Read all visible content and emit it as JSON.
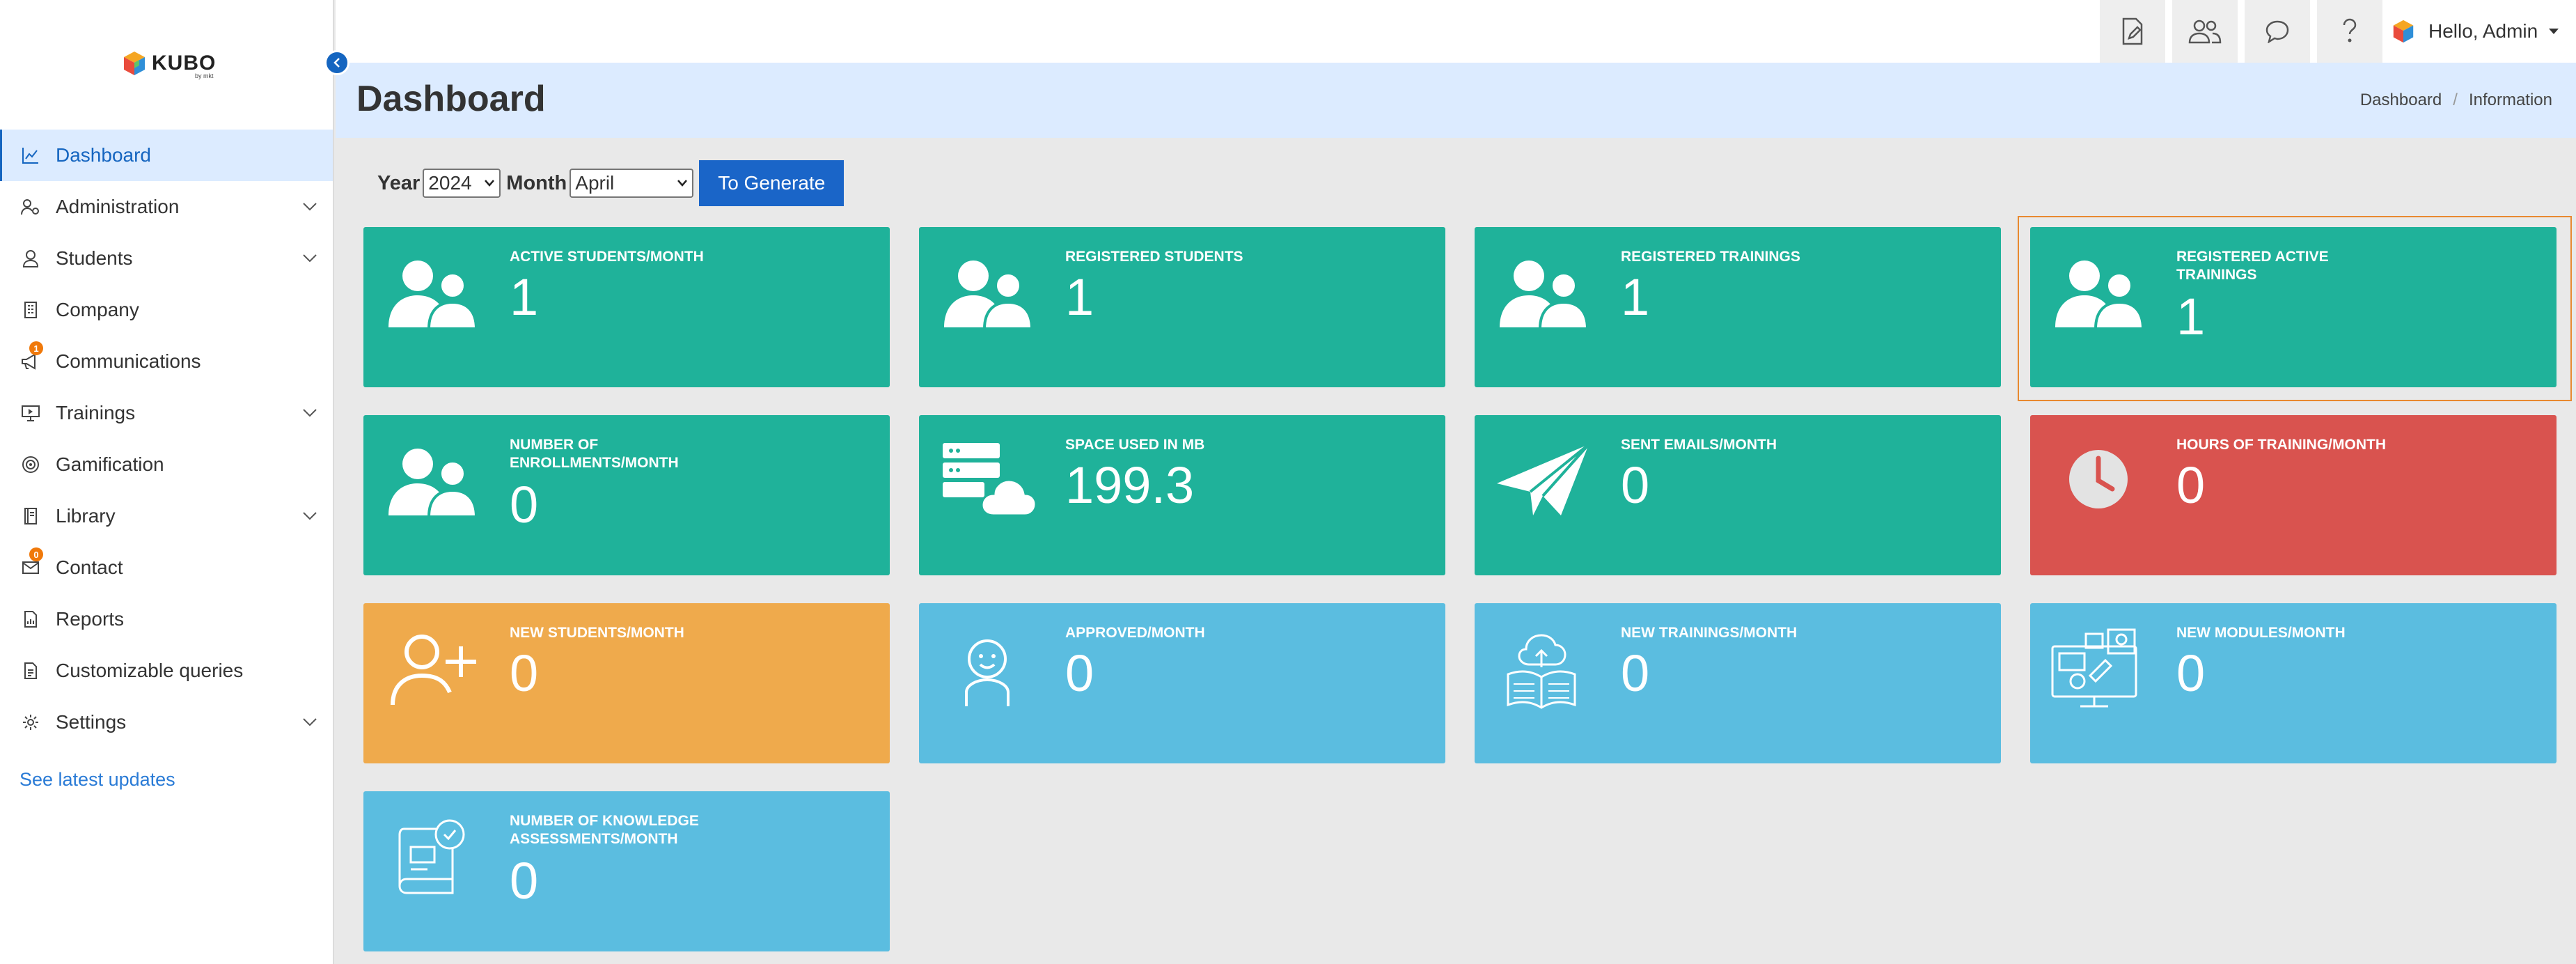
{
  "app": {
    "logo_text": "KUBO",
    "logo_sub": "by mkt"
  },
  "sidebar": {
    "items": [
      {
        "label": "Dashboard",
        "icon": "chart-line-icon",
        "active": true,
        "has_children": false,
        "badge": ""
      },
      {
        "label": "Administration",
        "icon": "users-cog-icon",
        "active": false,
        "has_children": true,
        "badge": ""
      },
      {
        "label": "Students",
        "icon": "user-icon",
        "active": false,
        "has_children": true,
        "badge": ""
      },
      {
        "label": "Company",
        "icon": "building-icon",
        "active": false,
        "has_children": false,
        "badge": ""
      },
      {
        "label": "Communications",
        "icon": "megaphone-icon",
        "active": false,
        "has_children": false,
        "badge": "1"
      },
      {
        "label": "Trainings",
        "icon": "presentation-icon",
        "active": false,
        "has_children": true,
        "badge": ""
      },
      {
        "label": "Gamification",
        "icon": "target-icon",
        "active": false,
        "has_children": false,
        "badge": ""
      },
      {
        "label": "Library",
        "icon": "book-icon",
        "active": false,
        "has_children": true,
        "badge": ""
      },
      {
        "label": "Contact",
        "icon": "envelope-icon",
        "active": false,
        "has_children": false,
        "badge": "0"
      },
      {
        "label": "Reports",
        "icon": "report-icon",
        "active": false,
        "has_children": false,
        "badge": ""
      },
      {
        "label": "Customizable queries",
        "icon": "document-icon",
        "active": false,
        "has_children": false,
        "badge": ""
      },
      {
        "label": "Settings",
        "icon": "gear-icon",
        "active": false,
        "has_children": true,
        "badge": ""
      }
    ],
    "latest_updates": "See latest updates"
  },
  "topbar": {
    "buttons": [
      "edit-document-icon",
      "users-icon",
      "chat-icon",
      "help-icon"
    ],
    "user_greeting": "Hello, Admin"
  },
  "header": {
    "title": "Dashboard",
    "breadcrumb": [
      "Dashboard",
      "Information"
    ]
  },
  "filters": {
    "year_label": "Year",
    "year_value": "2024",
    "month_label": "Month",
    "month_value": "April",
    "generate_label": "To Generate"
  },
  "cards": [
    {
      "label": "ACTIVE STUDENTS/MONTH",
      "value": "1",
      "color": "teal",
      "icon": "users-icon"
    },
    {
      "label": "REGISTERED STUDENTS",
      "value": "1",
      "color": "teal",
      "icon": "users-icon"
    },
    {
      "label": "REGISTERED TRAININGS",
      "value": "1",
      "color": "teal",
      "icon": "users-icon"
    },
    {
      "label": "REGISTERED ACTIVE TRAININGS",
      "value": "1",
      "color": "teal",
      "icon": "users-icon"
    },
    {
      "label": "NUMBER OF ENROLLMENTS/MONTH",
      "value": "0",
      "color": "teal",
      "icon": "users-icon"
    },
    {
      "label": "SPACE USED IN MB",
      "value": "199.3",
      "color": "teal",
      "icon": "server-cloud-icon"
    },
    {
      "label": "SENT EMAILS/MONTH",
      "value": "0",
      "color": "teal",
      "icon": "paper-plane-icon"
    },
    {
      "label": "HOURS OF TRAINING/MONTH",
      "value": "0",
      "color": "red",
      "icon": "clock-icon"
    },
    {
      "label": "NEW STUDENTS/MONTH",
      "value": "0",
      "color": "orange",
      "icon": "user-plus-icon"
    },
    {
      "label": "APPROVED/MONTH",
      "value": "0",
      "color": "blue",
      "icon": "smile-user-icon"
    },
    {
      "label": "NEW TRAININGS/MONTH",
      "value": "0",
      "color": "blue",
      "icon": "book-cloud-icon"
    },
    {
      "label": "NEW MODULES/MONTH",
      "value": "0",
      "color": "blue",
      "icon": "monitor-modules-icon"
    },
    {
      "label": "NUMBER OF KNOWLEDGE ASSESSMENTS/MONTH",
      "value": "0",
      "color": "blue",
      "icon": "assessment-book-icon"
    }
  ],
  "colors": {
    "teal": "#1fb29a",
    "red": "#d9534f",
    "orange": "#efaa4c",
    "blue": "#5bbde0",
    "accent": "#1565c0",
    "highlight": "#e8892f"
  }
}
